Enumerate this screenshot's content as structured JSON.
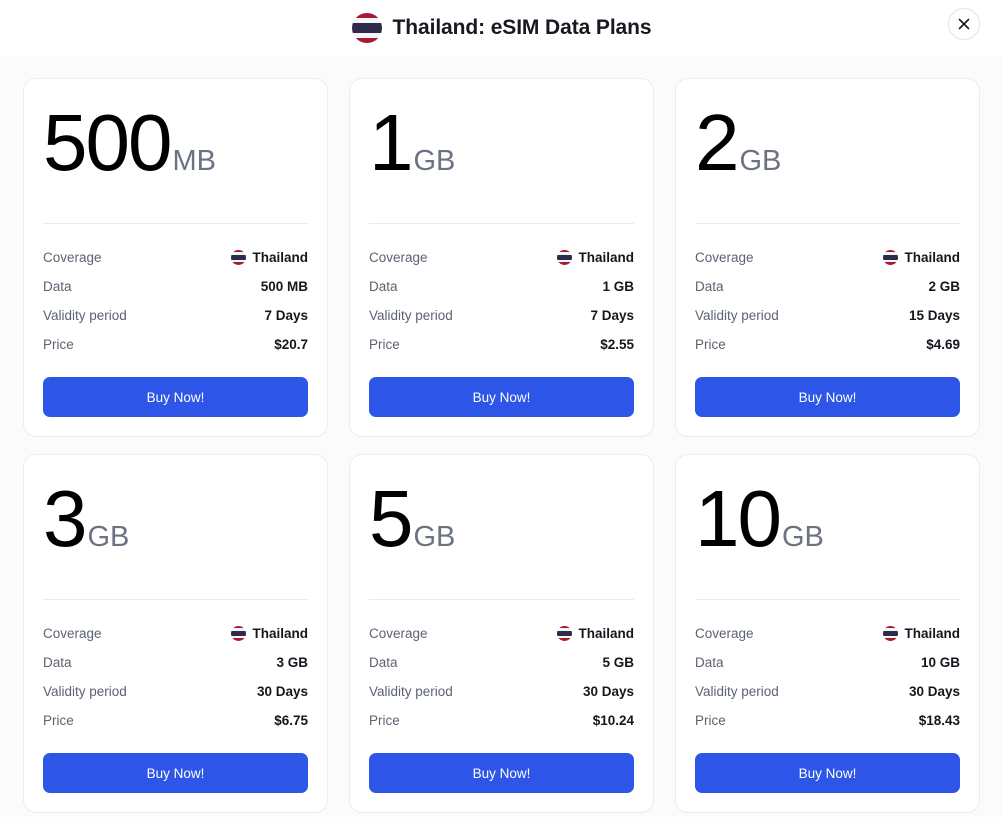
{
  "header": {
    "title": "Thailand: eSIM Data Plans",
    "flag_icon": "thailand-flag-icon",
    "close_label": "×"
  },
  "labels": {
    "coverage": "Coverage",
    "data": "Data",
    "validity": "Validity period",
    "price": "Price",
    "buy": "Buy Now!"
  },
  "colors": {
    "accent": "#2d56e8",
    "page_bg": "#fbfbfb",
    "card_bg": "#ffffff",
    "card_border": "#ececee",
    "unit_text": "#6b7280",
    "label_text": "#5b6270",
    "value_text": "#14171d"
  },
  "plans": [
    {
      "amount": "500",
      "unit": "MB",
      "coverage": "Thailand",
      "data": "500 MB",
      "validity": "7 Days",
      "price": "$20.7"
    },
    {
      "amount": "1",
      "unit": "GB",
      "coverage": "Thailand",
      "data": "1 GB",
      "validity": "7 Days",
      "price": "$2.55"
    },
    {
      "amount": "2",
      "unit": "GB",
      "coverage": "Thailand",
      "data": "2 GB",
      "validity": "15 Days",
      "price": "$4.69"
    },
    {
      "amount": "3",
      "unit": "GB",
      "coverage": "Thailand",
      "data": "3 GB",
      "validity": "30 Days",
      "price": "$6.75"
    },
    {
      "amount": "5",
      "unit": "GB",
      "coverage": "Thailand",
      "data": "5 GB",
      "validity": "30 Days",
      "price": "$10.24"
    },
    {
      "amount": "10",
      "unit": "GB",
      "coverage": "Thailand",
      "data": "10 GB",
      "validity": "30 Days",
      "price": "$18.43"
    }
  ]
}
